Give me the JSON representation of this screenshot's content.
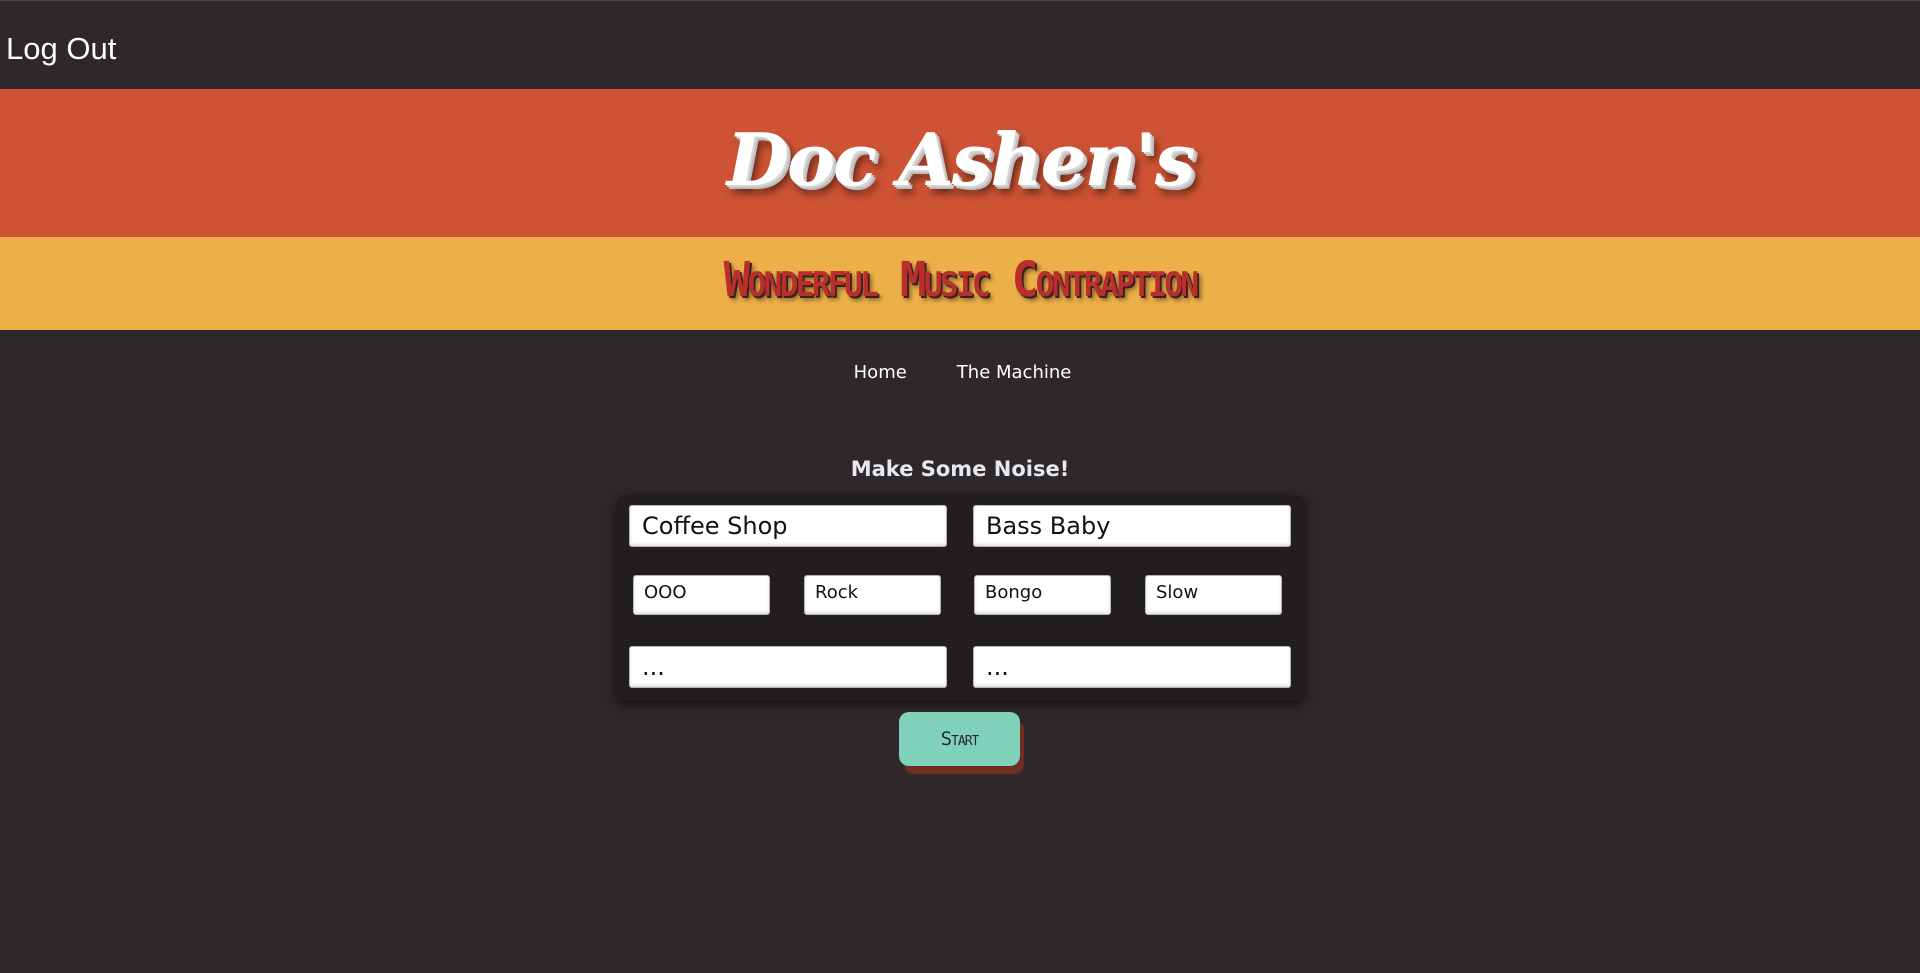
{
  "topbar": {
    "logout_label": "Log Out"
  },
  "header": {
    "title": "Doc Ashen's",
    "subtitle": "Wonderful Music Contraption"
  },
  "nav": {
    "items": [
      {
        "label": "Home"
      },
      {
        "label": "The Machine"
      }
    ]
  },
  "main": {
    "heading": "Make Some Noise!",
    "fields": {
      "setting": "Coffee Shop",
      "name": "Bass Baby",
      "mood": "OOO",
      "genre": "Rock",
      "instrument": "Bongo",
      "tempo": "Slow",
      "left_note": "...",
      "right_note": "..."
    },
    "start_label": "Start"
  },
  "colors": {
    "background": "#2e282a",
    "header_red": "#cd5334",
    "header_yellow": "#edb048",
    "subtitle_red": "#b92f2c",
    "start_button": "#7fd1ba"
  }
}
